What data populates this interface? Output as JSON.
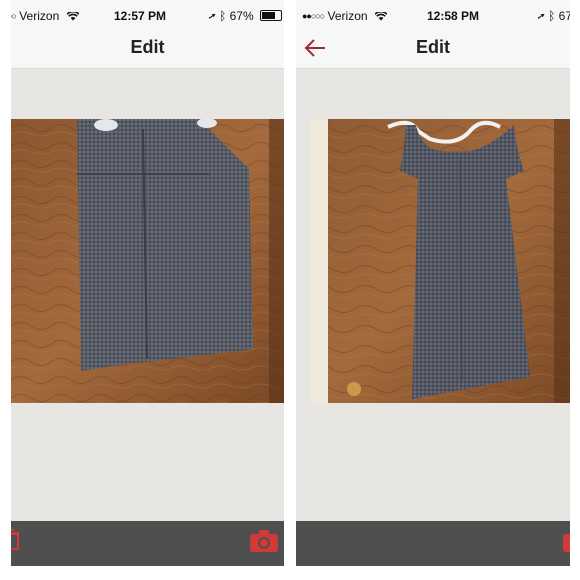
{
  "screens": [
    {
      "status": {
        "carrier": "Verizon",
        "time": "12:57 PM",
        "battery": "67%"
      },
      "nav": {
        "title": "Edit"
      },
      "icons": {
        "trash": "trash-icon",
        "camera": "camera-icon"
      },
      "photo": {
        "subject": "skirt-photo"
      }
    },
    {
      "status": {
        "carrier": "Verizon",
        "time": "12:58 PM",
        "battery": "67"
      },
      "nav": {
        "title": "Edit"
      },
      "icons": {
        "back": "back-arrow-icon",
        "camera": "camera-icon"
      },
      "photo": {
        "subject": "dress-photo"
      }
    }
  ],
  "colors": {
    "accent": "#d23a3a",
    "back": "#9b2c3c",
    "toolbar": "#4f4f4f"
  }
}
